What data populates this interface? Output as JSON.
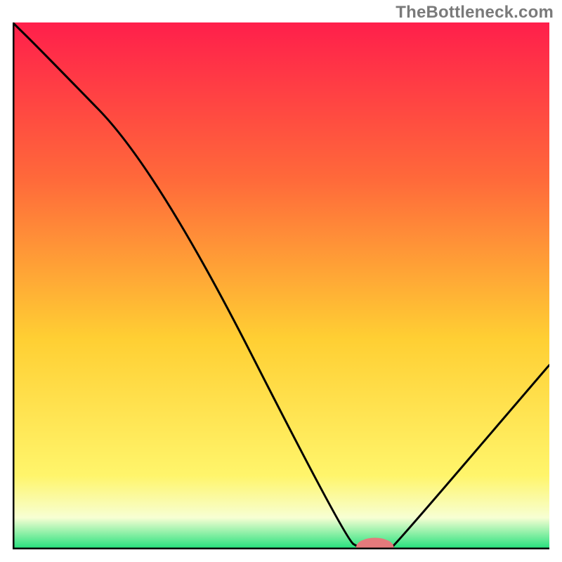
{
  "watermark": {
    "text": "TheBottleneck.com"
  },
  "colors": {
    "axis": "#000000",
    "curve": "#000000",
    "marker_fill": "#e47a7c",
    "grad_top": "#ff1f4b",
    "grad_mid_upper": "#ff6a3a",
    "grad_mid": "#ffcf33",
    "grad_low_yellow": "#fff56b",
    "grad_pale": "#f7ffd3",
    "grad_green": "#1fe07a"
  },
  "chart_data": {
    "type": "line",
    "title": "",
    "xlabel": "",
    "ylabel": "",
    "xlim": [
      0,
      100
    ],
    "ylim": [
      0,
      100
    ],
    "x": [
      0,
      5,
      27,
      62,
      65,
      70,
      71,
      100
    ],
    "values": [
      100,
      95,
      72,
      2,
      0,
      0,
      0.5,
      35
    ],
    "marker": {
      "x": 67.5,
      "y": 0,
      "rx": 3.5,
      "ry": 1.4
    },
    "gradient_stops": [
      {
        "offset": 0.0,
        "key": "grad_top"
      },
      {
        "offset": 0.3,
        "key": "grad_mid_upper"
      },
      {
        "offset": 0.6,
        "key": "grad_mid"
      },
      {
        "offset": 0.86,
        "key": "grad_low_yellow"
      },
      {
        "offset": 0.94,
        "key": "grad_pale"
      },
      {
        "offset": 1.0,
        "key": "grad_green"
      }
    ]
  }
}
